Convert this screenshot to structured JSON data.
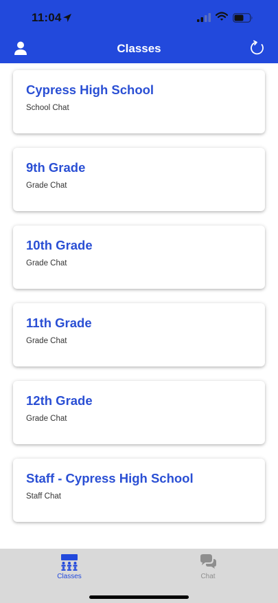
{
  "status_bar": {
    "time": "11:04"
  },
  "header": {
    "title": "Classes"
  },
  "classes": [
    {
      "name": "Cypress High School",
      "type": "School Chat"
    },
    {
      "name": "9th Grade",
      "type": "Grade Chat"
    },
    {
      "name": "10th Grade",
      "type": "Grade Chat"
    },
    {
      "name": "11th Grade",
      "type": "Grade Chat"
    },
    {
      "name": "12th Grade",
      "type": "Grade Chat"
    },
    {
      "name": "Staff - Cypress High School",
      "type": "Staff Chat"
    }
  ],
  "tabs": [
    {
      "label": "Classes",
      "icon": "classes-icon",
      "active": true
    },
    {
      "label": "Chat",
      "icon": "chat-icon",
      "active": false
    }
  ],
  "colors": {
    "accent": "#2249dc",
    "title_text": "#2a4fd4",
    "tabbar_bg": "#d9d9d9",
    "inactive_tab": "#8e8e8e"
  }
}
